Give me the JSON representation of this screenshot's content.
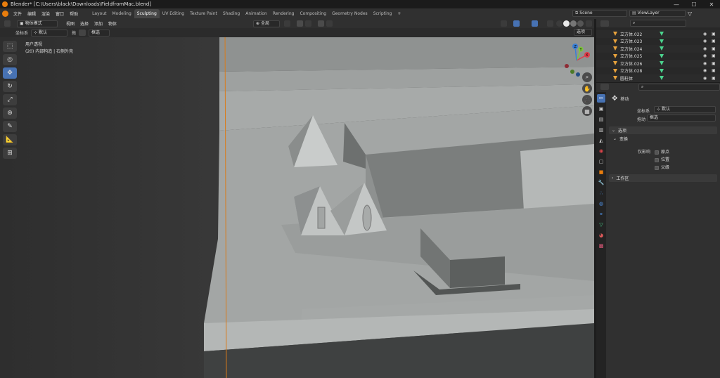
{
  "window": {
    "title": "Blender* [C:\\Users\\black\\Downloads\\FieldfromMac.blend]",
    "minimize": "—",
    "maximize": "☐",
    "close": "✕"
  },
  "menubar": {
    "menus": [
      "文件",
      "编辑",
      "渲染",
      "窗口",
      "帮助"
    ],
    "workspaces": [
      "Layout",
      "Modeling",
      "Sculpting",
      "UV Editing",
      "Texture Paint",
      "Shading",
      "Animation",
      "Rendering",
      "Compositing",
      "Geometry Nodes",
      "Scripting"
    ],
    "active_workspace": "Sculpting",
    "add_tab": "+",
    "scene": "Scene",
    "view_layer": "ViewLayer"
  },
  "header3d": {
    "mode": "物体模式",
    "menus": [
      "视图",
      "选择",
      "添加",
      "物体"
    ],
    "transform_orientation": "全局"
  },
  "header_tool": {
    "coord_label": "坐标系",
    "coord_value": "默认",
    "drag_label": "拖",
    "drag_value": "框选",
    "options": "选项"
  },
  "viewport": {
    "view_name": "用户透视",
    "collection_info": "(20) 内部构造 | 右侧外壳"
  },
  "gizmo": {
    "x": "X",
    "y": "Y",
    "z": "Z"
  },
  "outliner": {
    "items": [
      "立方体.022",
      "立方体.023",
      "立方体.024",
      "立方体.025",
      "立方体.026",
      "立方体.028",
      "圆柱体"
    ]
  },
  "properties": {
    "tool_title": "移动",
    "coord_label": "坐标系",
    "coord_value": "默认",
    "drag_label": "拖动",
    "drag_value": "框选",
    "section_options": "选项",
    "section_transform": "变换",
    "affect_only_label": "仅影响",
    "affect_origins": "原点",
    "affect_locations": "位置",
    "affect_parents": "父级",
    "section_workspace": "工作区"
  },
  "colors": {
    "accent": "#4772b3",
    "orange": "#e87d0d",
    "green_mesh": "#4bd48e",
    "x_axis": "#e03c4a",
    "y_axis": "#7ec83a",
    "z_axis": "#3a7fd5"
  }
}
